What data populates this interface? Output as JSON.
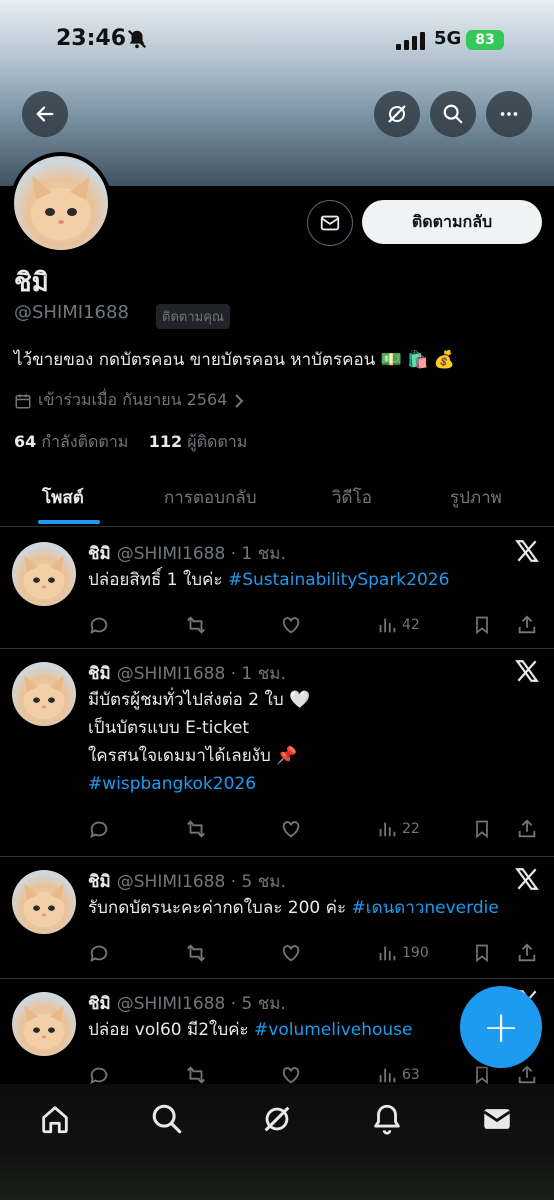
{
  "status_bar": {
    "time": "23:46",
    "network": "5G",
    "battery": "83"
  },
  "header": {
    "back_icon": "arrow-left-icon",
    "grok_icon": "grok-icon",
    "search_icon": "search-icon",
    "more_icon": "more-icon"
  },
  "profile": {
    "name": "ชิมิ",
    "handle": "@SHIMI1688",
    "follows_you": "ติดตามคุณ",
    "follow_back_label": "ติดตามกลับ",
    "bio": "ไว้ขายของ กดบัตรคอน ขายบัตรคอน หาบัตรคอน 💵 🛍️ 💰",
    "joined": "เข้าร่วมเมื่อ กันยายน 2564",
    "following_count": "64",
    "following_label": "กำลังติดตาม",
    "followers_count": "112",
    "followers_label": "ผู้ติดตาม"
  },
  "tabs": [
    {
      "label": "โพสต์"
    },
    {
      "label": "การตอบกลับ"
    },
    {
      "label": "วิดีโอ"
    },
    {
      "label": "รูปภาพ"
    }
  ],
  "posts": [
    {
      "name": "ชิมิ",
      "meta": "@SHIMI1688 · 1 ชม.",
      "lines": [
        "ปล่อยสิทธิ์ 1 ใบค่ะ "
      ],
      "tag": "#SustainabilitySpark2026",
      "views": "42"
    },
    {
      "name": "ชิมิ",
      "meta": "@SHIMI1688 · 1 ชม.",
      "lines": [
        "มีบัตรผู้ชมทั่วไปส่งต่อ 2 ใบ 🤍",
        " เป็นบัตรแบบ E-ticket",
        "ใครสนใจเดมมาได้เลยงับ 📌"
      ],
      "tag": "#wispbangkok2026",
      "views": "22"
    },
    {
      "name": "ชิมิ",
      "meta": "@SHIMI1688 · 5 ชม.",
      "lines": [
        "รับกดบัตรนะคะค่ากดใบละ 200 ค่ะ "
      ],
      "tag": "#เดนดาวneverdie",
      "views": "190"
    },
    {
      "name": "ชิมิ",
      "meta": "@SHIMI1688 · 5 ชม.",
      "lines": [
        "ปล่อย vol60 มี2ใบค่ะ "
      ],
      "tag": "#volumelivehouse",
      "views": "63"
    }
  ],
  "fab_label": "+",
  "bottom_nav": [
    "home-icon",
    "search-icon",
    "grok-icon",
    "notifications-icon",
    "messages-icon"
  ]
}
